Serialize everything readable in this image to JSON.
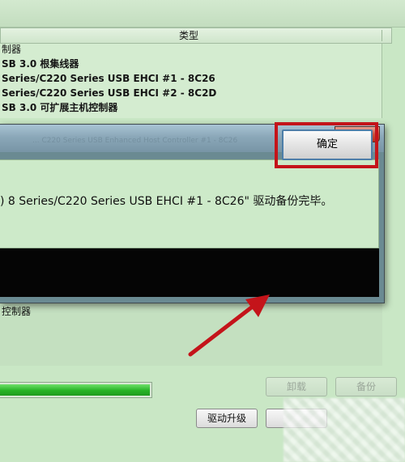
{
  "header": {
    "type_column": "类型",
    "group_label": "制器"
  },
  "devices": [
    "SB 3.0 根集线器",
    "Series/C220 Series USB EHCI #1 - 8C26",
    "Series/C220 Series USB EHCI #2 - 8C2D",
    "SB 3.0 可扩展主机控制器"
  ],
  "dialog": {
    "title": "... C220 Series USB Enhanced Host Controller #1 - 8C26",
    "close_label": "✕",
    "message": ") 8 Series/C220 Series USB EHCI #1 - 8C26\" 驱动备份完毕。",
    "ok_label": "确定"
  },
  "lower_list": {
    "item": "控制器"
  },
  "progress": {
    "value": 1.0
  },
  "buttons": {
    "uninstall": "卸载",
    "backup": "备份",
    "upgrade": "驱动升级"
  },
  "colors": {
    "window_bg": "#c9e7c5",
    "progress_fill": "#27b326",
    "highlight": "#c4141a",
    "arrow": "#c4141a"
  }
}
